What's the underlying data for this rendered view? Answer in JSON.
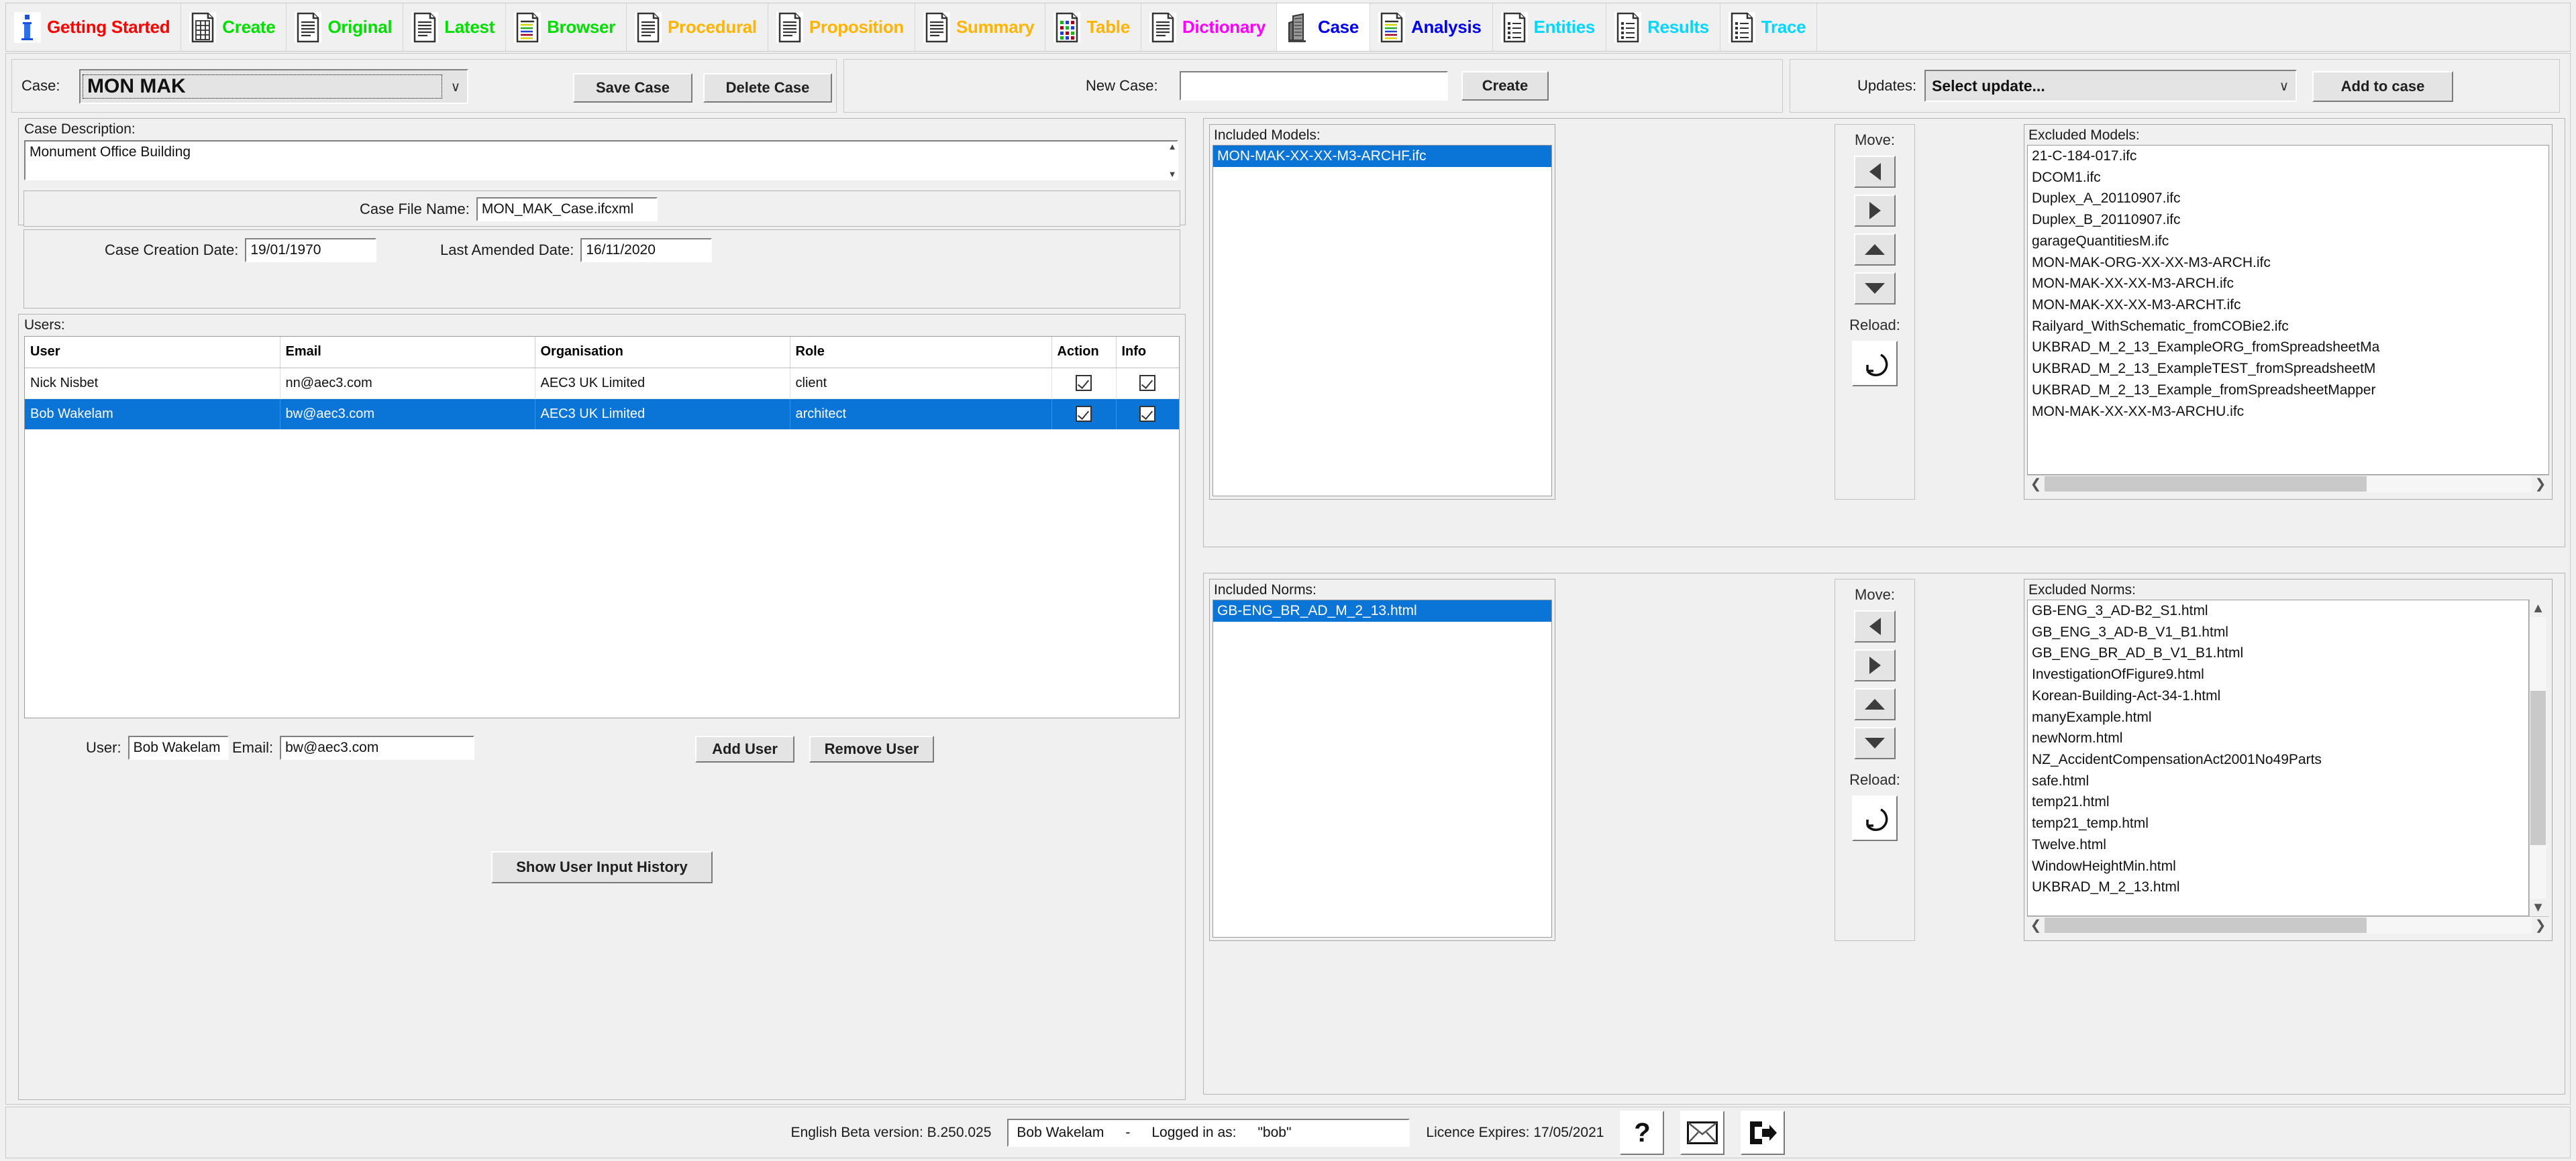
{
  "toolbar": {
    "items": [
      {
        "label": "Getting Started",
        "color": "#ff0000",
        "icon": "info-icon",
        "active": false
      },
      {
        "label": "Create",
        "color": "#00e000",
        "icon": "document-grid-icon",
        "active": false
      },
      {
        "label": "Original",
        "color": "#00e000",
        "icon": "document-icon",
        "active": false
      },
      {
        "label": "Latest",
        "color": "#00e000",
        "icon": "document-icon",
        "active": false
      },
      {
        "label": "Browser",
        "color": "#00e000",
        "icon": "document-color-icon",
        "active": false
      },
      {
        "label": "Procedural",
        "color": "#ffb400",
        "icon": "document-icon",
        "active": false
      },
      {
        "label": "Proposition",
        "color": "#ffb400",
        "icon": "document-icon",
        "active": false
      },
      {
        "label": "Summary",
        "color": "#ffb400",
        "icon": "document-icon",
        "active": false
      },
      {
        "label": "Table",
        "color": "#ffb400",
        "icon": "document-table-icon",
        "active": false
      },
      {
        "label": "Dictionary",
        "color": "#ff00ff",
        "icon": "document-icon",
        "active": false
      },
      {
        "label": "Case",
        "color": "#0000ee",
        "icon": "building-icon",
        "active": true
      },
      {
        "label": "Analysis",
        "color": "#0000ee",
        "icon": "document-color-icon",
        "active": false
      },
      {
        "label": "Entities",
        "color": "#00d8ff",
        "icon": "document-list-icon",
        "active": false
      },
      {
        "label": "Results",
        "color": "#00d8ff",
        "icon": "document-list-icon",
        "active": false
      },
      {
        "label": "Trace",
        "color": "#00d8ff",
        "icon": "document-list-icon",
        "active": false
      }
    ]
  },
  "topbar": {
    "case_label": "Case:",
    "case_value": "MON MAK",
    "save_case_label": "Save Case",
    "delete_case_label": "Delete Case",
    "new_case_label": "New Case:",
    "new_case_value": "",
    "create_label": "Create",
    "updates_label": "Updates:",
    "updates_value": "Select update...",
    "add_to_case_label": "Add to case"
  },
  "case_details": {
    "description_label": "Case Description:",
    "description_value": "Monument Office Building",
    "file_name_label": "Case File Name:",
    "file_name_value": "MON_MAK_Case.ifcxml",
    "creation_date_label": "Case Creation Date:",
    "creation_date_value": "19/01/1970",
    "amended_date_label": "Last Amended Date:",
    "amended_date_value": "16/11/2020"
  },
  "users": {
    "title": "Users:",
    "columns": [
      "User",
      "Email",
      "Organisation",
      "Role",
      "Action",
      "Info"
    ],
    "rows": [
      {
        "user": "Nick Nisbet",
        "email": "nn@aec3.com",
        "organisation": "AEC3 UK Limited",
        "role": "client",
        "action": true,
        "info": true,
        "selected": false
      },
      {
        "user": "Bob Wakelam",
        "email": "bw@aec3.com",
        "organisation": "AEC3 UK Limited",
        "role": "architect",
        "action": true,
        "info": true,
        "selected": true
      }
    ],
    "form": {
      "user_label": "User:",
      "user_value": "Bob Wakelam",
      "email_label": "Email:",
      "email_value": "bw@aec3.com",
      "add_user_label": "Add User",
      "remove_user_label": "Remove User"
    },
    "history_button_label": "Show User Input History"
  },
  "models": {
    "included_title": "Included Models:",
    "included_items": [
      "MON-MAK-XX-XX-M3-ARCHF.ifc"
    ],
    "included_selected_index": 0,
    "move_label": "Move:",
    "reload_label": "Reload:",
    "excluded_title": "Excluded Models:",
    "excluded_items": [
      "21-C-184-017.ifc",
      "DCOM1.ifc",
      "Duplex_A_20110907.ifc",
      "Duplex_B_20110907.ifc",
      "garageQuantitiesM.ifc",
      "MON-MAK-ORG-XX-XX-M3-ARCH.ifc",
      "MON-MAK-XX-XX-M3-ARCH.ifc",
      "MON-MAK-XX-XX-M3-ARCHT.ifc",
      "Railyard_WithSchematic_fromCOBie2.ifc",
      "UKBRAD_M_2_13_ExampleORG_fromSpreadsheetMa",
      "UKBRAD_M_2_13_ExampleTEST_fromSpreadsheetM",
      "UKBRAD_M_2_13_Example_fromSpreadsheetMapper",
      "MON-MAK-XX-XX-M3-ARCHU.ifc"
    ]
  },
  "norms": {
    "included_title": "Included Norms:",
    "included_items": [
      "GB-ENG_BR_AD_M_2_13.html"
    ],
    "included_selected_index": 0,
    "move_label": "Move:",
    "reload_label": "Reload:",
    "excluded_title": "Excluded Norms:",
    "excluded_items": [
      "GB-ENG_3_AD-B2_S1.html",
      "GB_ENG_3_AD-B_V1_B1.html",
      "GB_ENG_BR_AD_B_V1_B1.html",
      "InvestigationOfFigure9.html",
      "Korean-Building-Act-34-1.html",
      "manyExample.html",
      "newNorm.html",
      "NZ_AccidentCompensationAct2001No49Parts",
      "safe.html",
      "temp21.html",
      "temp21_temp.html",
      "Twelve.html",
      "WindowHeightMin.html",
      "UKBRAD_M_2_13.html"
    ]
  },
  "statusbar": {
    "version_text": "English Beta version: B.250.025",
    "user_name": "Bob Wakelam",
    "separator": "-",
    "logged_in_label": "Logged in as:",
    "logged_in_value": "\"bob\"",
    "licence_text": "Licence Expires: 17/05/2021",
    "help_icon": "question-mark-icon",
    "mail_icon": "envelope-icon",
    "logout_icon": "exit-icon"
  },
  "colors": {
    "selection_blue": "#0b75d7",
    "panel_bg": "#f0f0f0",
    "field_bg": "#ffffff"
  }
}
